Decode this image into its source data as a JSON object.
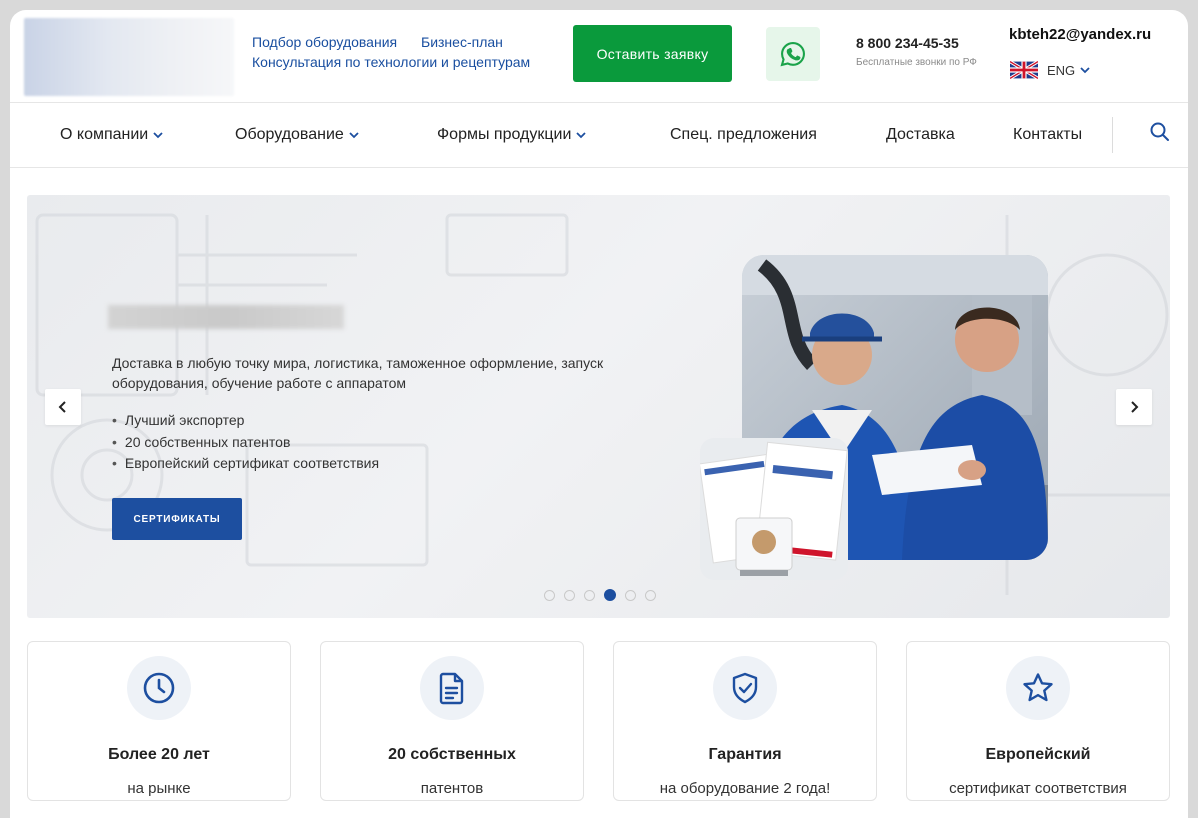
{
  "header": {
    "links": [
      "Подбор оборудования",
      "Бизнес-план",
      "Консультация по технологии и рецептурам"
    ],
    "cta_label": "Оставить заявку",
    "phone": "8 800 234-45-35",
    "phone_note": "Бесплатные звонки по РФ",
    "email": "kbteh22@yandex.ru",
    "language": "ENG"
  },
  "nav": {
    "items": [
      {
        "label": "О компании",
        "dropdown": true
      },
      {
        "label": "Оборудование",
        "dropdown": true
      },
      {
        "label": "Формы продукции",
        "dropdown": true
      },
      {
        "label": "Спец. предложения",
        "dropdown": false
      },
      {
        "label": "Доставка",
        "dropdown": false
      },
      {
        "label": "Контакты",
        "dropdown": false
      }
    ]
  },
  "hero": {
    "description": "Доставка в любую точку мира, логистика, таможенное оформление, запуск оборудования, обучение работе с аппаратом",
    "bullets": [
      "Лучший экспортер",
      "20 собственных патентов",
      "Европейский сертификат соответствия"
    ],
    "button_label": "СЕРТИФИКАТЫ",
    "slides_count": 6,
    "active_slide": 4
  },
  "features": [
    {
      "title": "Более 20 лет",
      "subtitle": "на рынке",
      "icon": "clock-icon"
    },
    {
      "title": "20 собственных",
      "subtitle": "патентов",
      "icon": "document-icon"
    },
    {
      "title": "Гарантия",
      "subtitle": "на оборудование 2 года!",
      "icon": "shield-check-icon"
    },
    {
      "title": "Европейский",
      "subtitle": "сертификат соответствия",
      "icon": "star-icon"
    }
  ],
  "colors": {
    "brand_blue": "#1d4fa0",
    "cta_green": "#0a9a3c",
    "link_blue": "#1a4fa0"
  }
}
